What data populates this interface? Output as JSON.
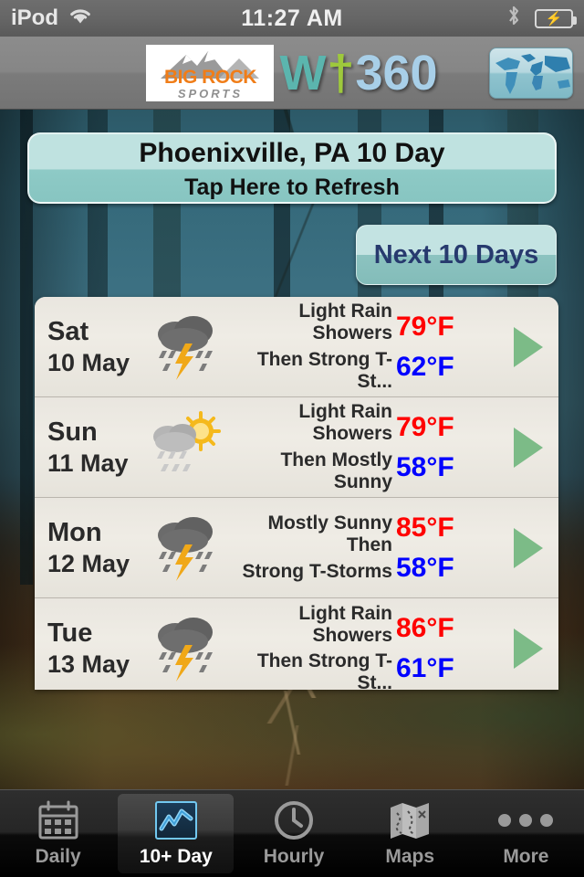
{
  "statusbar": {
    "carrier": "iPod",
    "wifi_icon": "wifi-icon",
    "time": "11:27 AM",
    "bluetooth_icon": "bluetooth-icon",
    "battery_icon": "battery-charging-icon"
  },
  "header": {
    "logo_primary": "BIG ROCK",
    "logo_secondary": "SPORTS",
    "brand_w": "W",
    "brand_cross": "†",
    "brand_number": "360",
    "map_button_icon": "world-map-icon"
  },
  "title": {
    "location": "Phoenixville, PA 10 Day",
    "refresh_hint": "Tap Here to Refresh"
  },
  "next_button": {
    "label": "Next 10 Days"
  },
  "forecast": {
    "rows": [
      {
        "dow": "Sat",
        "date": "10 May",
        "icon": "thunderstorm-rain-icon",
        "desc_line1": "Light Rain Showers",
        "desc_line2": "Then Strong T-St...",
        "high": "79°F",
        "low": "62°F",
        "arrow": "chevron-right-icon"
      },
      {
        "dow": "Sun",
        "date": "11 May",
        "icon": "sun-behind-rain-cloud-icon",
        "desc_line1": "Light Rain Showers",
        "desc_line2": "Then Mostly Sunny",
        "high": "79°F",
        "low": "58°F",
        "arrow": "chevron-right-icon"
      },
      {
        "dow": "Mon",
        "date": "12 May",
        "icon": "thunderstorm-rain-icon",
        "desc_line1": "Mostly Sunny Then",
        "desc_line2": "Strong T-Storms",
        "high": "85°F",
        "low": "58°F",
        "arrow": "chevron-right-icon"
      },
      {
        "dow": "Tue",
        "date": "13 May",
        "icon": "thunderstorm-rain-icon",
        "desc_line1": "Light Rain Showers",
        "desc_line2": "Then Strong T-St...",
        "high": "86°F",
        "low": "61°F",
        "arrow": "chevron-right-icon"
      }
    ]
  },
  "tabbar": {
    "tabs": [
      {
        "label": "Daily",
        "icon": "calendar-icon",
        "active": false
      },
      {
        "label": "10+ Day",
        "icon": "line-chart-icon",
        "active": true
      },
      {
        "label": "Hourly",
        "icon": "clock-icon",
        "active": false
      },
      {
        "label": "Maps",
        "icon": "folded-map-icon",
        "active": false
      },
      {
        "label": "More",
        "icon": "ellipsis-icon",
        "active": false
      }
    ]
  },
  "colors": {
    "high_temp": "#ff0000",
    "low_temp": "#0000ff",
    "accent_teal": "#8ecac6",
    "arrow_green": "#7cbb87",
    "active_tab_blue": "#72c8f0",
    "brand_orange": "#f07d18"
  }
}
